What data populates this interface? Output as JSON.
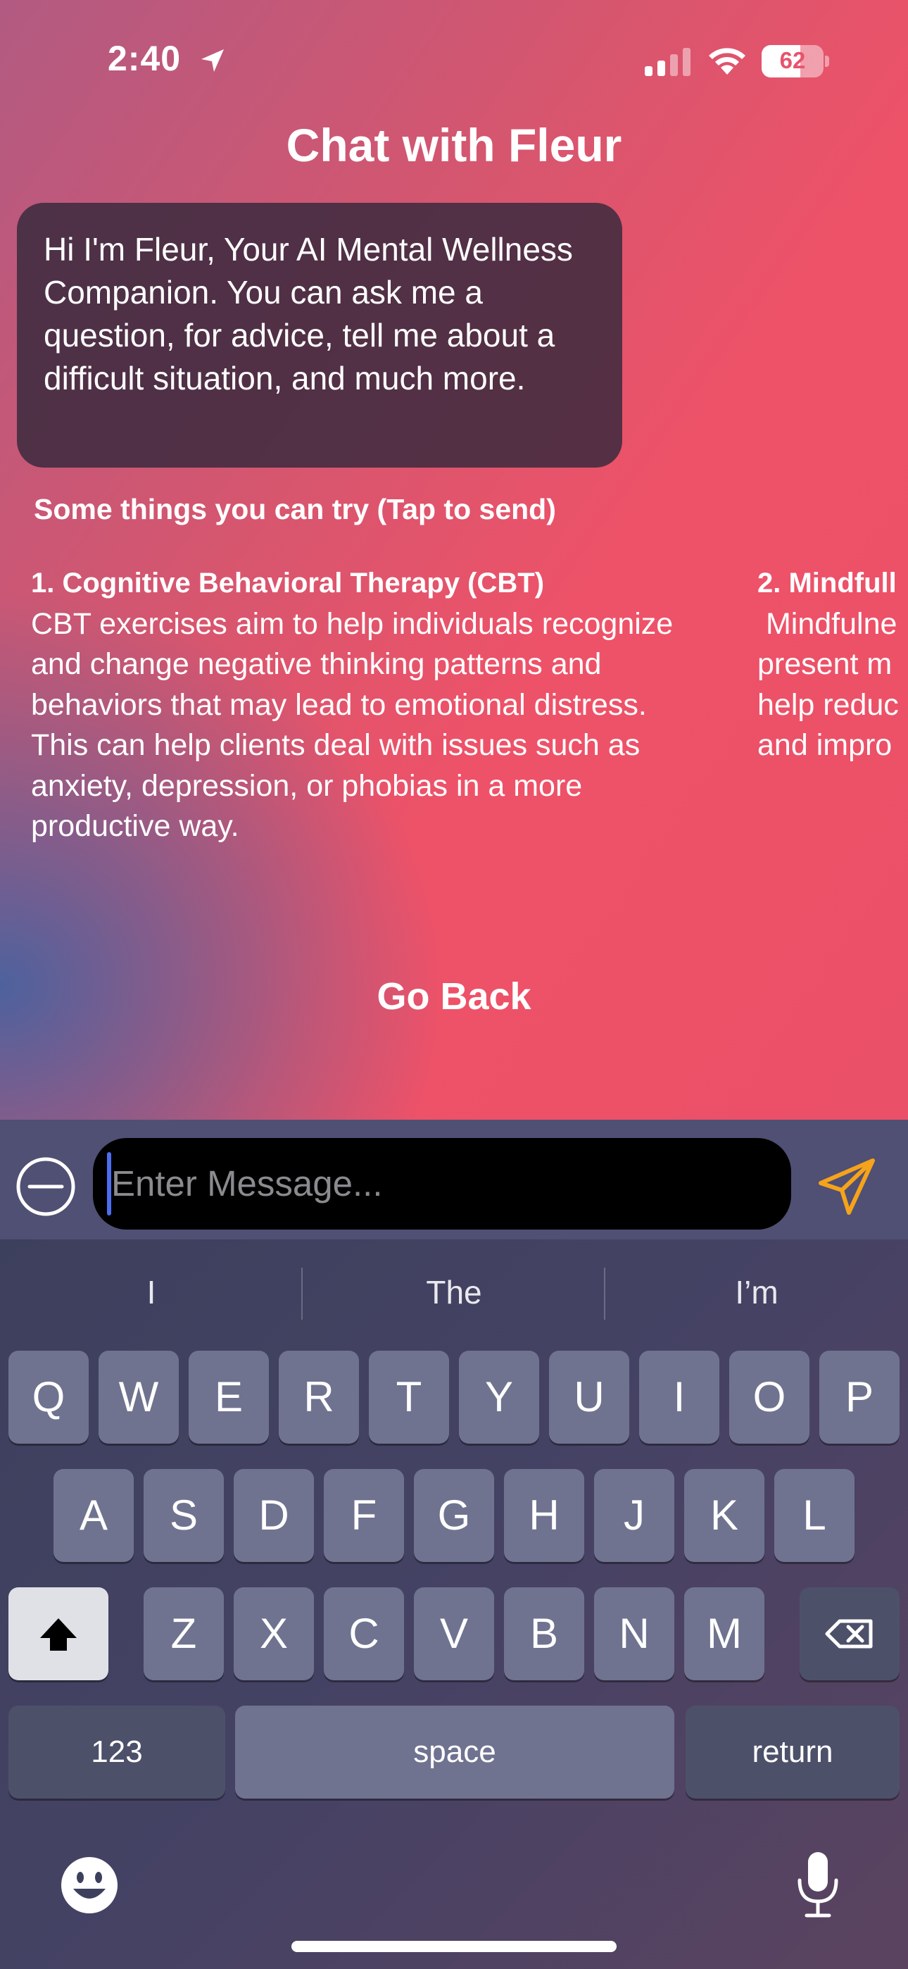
{
  "status_bar": {
    "time": "2:40",
    "battery_level": "62",
    "battery_fraction": 0.62,
    "icons": [
      "location-arrow-icon",
      "cellular-signal-icon",
      "wifi-icon",
      "battery-icon"
    ]
  },
  "header": {
    "title": "Chat with Fleur"
  },
  "chat": {
    "greeting": "Hi I'm Fleur, Your AI Mental Wellness Companion. You can ask me a question, for advice, tell me about a difficult situation, and much more."
  },
  "suggestions": {
    "heading": "Some things you can try (Tap to send)",
    "items": [
      {
        "title": "1. Cognitive Behavioral Therapy (CBT)",
        "body": "CBT exercises aim to help individuals recognize and change negative thinking patterns and behaviors that may lead to emotional distress. This can help clients deal with issues such as anxiety, depression, or phobias in a more productive way."
      },
      {
        "title": "2. Mindfull",
        "body_lines": [
          " Mindfulne",
          "present m",
          "help reduc",
          "and impro"
        ]
      }
    ]
  },
  "go_back_label": "Go Back",
  "composer": {
    "placeholder": "Enter Message...",
    "left_icon": "minus-circle-icon",
    "send_icon": "send-icon",
    "send_color": "#f5a31a"
  },
  "keyboard": {
    "suggestions": [
      "I",
      "The",
      "I’m"
    ],
    "row1": [
      "Q",
      "W",
      "E",
      "R",
      "T",
      "Y",
      "U",
      "I",
      "O",
      "P"
    ],
    "row2": [
      "A",
      "S",
      "D",
      "F",
      "G",
      "H",
      "J",
      "K",
      "L"
    ],
    "row3": [
      "Z",
      "X",
      "C",
      "V",
      "B",
      "N",
      "M"
    ],
    "numbers_label": "123",
    "space_label": "space",
    "return_label": "return",
    "icons": [
      "shift-icon",
      "backspace-icon",
      "emoji-icon",
      "microphone-icon"
    ]
  }
}
